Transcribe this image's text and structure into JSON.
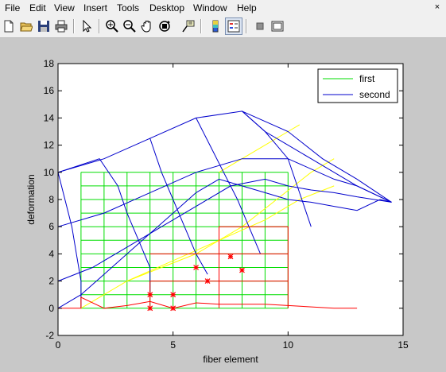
{
  "menu": [
    "File",
    "Edit",
    "View",
    "Insert",
    "Tools",
    "Desktop",
    "Window",
    "Help"
  ],
  "window_close": "×",
  "toolbar": {
    "buttons": [
      {
        "name": "new-figure-icon"
      },
      {
        "name": "open-file-icon"
      },
      {
        "name": "save-icon"
      },
      {
        "name": "print-icon"
      },
      {
        "name": "edit-plot-arrow-icon"
      },
      {
        "name": "zoom-in-icon"
      },
      {
        "name": "zoom-out-icon"
      },
      {
        "name": "pan-hand-icon"
      },
      {
        "name": "rotate-3d-icon"
      },
      {
        "name": "data-cursor-icon"
      },
      {
        "name": "insert-colorbar-icon"
      },
      {
        "name": "insert-legend-icon"
      },
      {
        "name": "hide-plot-tools-icon"
      },
      {
        "name": "show-plot-tools-icon"
      }
    ]
  },
  "chart_data": {
    "type": "line",
    "title": "",
    "xlabel": "fiber element",
    "ylabel": "deformation",
    "xlim": [
      0,
      15
    ],
    "ylim": [
      -2,
      18
    ],
    "xticks": [
      "0",
      "5",
      "10",
      "15"
    ],
    "yticks": [
      "-2",
      "0",
      "2",
      "4",
      "6",
      "8",
      "10",
      "12",
      "14",
      "16",
      "18"
    ],
    "grid": false,
    "legend": {
      "position": "top-right",
      "entries": [
        {
          "label": "first",
          "color": "#00dd00"
        },
        {
          "label": "second",
          "color": "#0000cc"
        }
      ]
    },
    "series": [
      {
        "name": "first",
        "color": "#00dd00",
        "grid_x": [
          1,
          2,
          3,
          4,
          5,
          6,
          7,
          8,
          9,
          10
        ],
        "grid_y": [
          0,
          1,
          2,
          3,
          4,
          5,
          6,
          7,
          8,
          9,
          10
        ]
      },
      {
        "name": "second",
        "color": "#0000cc",
        "i_lines": [
          [
            [
              0,
              0
            ],
            [
              1,
              1
            ],
            [
              2,
              2.5
            ],
            [
              3,
              4
            ],
            [
              4,
              5.5
            ],
            [
              5,
              7
            ],
            [
              6,
              8.5
            ],
            [
              7,
              9.5
            ],
            [
              8,
              9
            ],
            [
              9,
              8.5
            ],
            [
              10,
              8
            ],
            [
              11,
              7.8
            ],
            [
              12,
              7.5
            ],
            [
              13,
              7.2
            ],
            [
              14,
              8
            ],
            [
              14.5,
              7.8
            ]
          ],
          [
            [
              0,
              2
            ],
            [
              1.5,
              3
            ],
            [
              3,
              4.5
            ],
            [
              4.5,
              6
            ],
            [
              6,
              7.5
            ],
            [
              7.5,
              9
            ],
            [
              9,
              9.5
            ],
            [
              10,
              9
            ],
            [
              11,
              8.7
            ],
            [
              12,
              8.5
            ],
            [
              13,
              8.2
            ],
            [
              14.5,
              7.8
            ]
          ],
          [
            [
              0,
              6
            ],
            [
              2,
              7
            ],
            [
              4,
              8.5
            ],
            [
              6,
              10
            ],
            [
              8,
              11
            ],
            [
              10,
              11
            ],
            [
              12,
              9.5
            ],
            [
              13,
              9
            ],
            [
              14.5,
              7.8
            ]
          ],
          [
            [
              0,
              10
            ],
            [
              2,
              11
            ],
            [
              4,
              12.5
            ],
            [
              6,
              14
            ],
            [
              8,
              14.5
            ],
            [
              9,
              13
            ],
            [
              10,
              12
            ],
            [
              11,
              11
            ],
            [
              12,
              10
            ],
            [
              13,
              9
            ],
            [
              14.5,
              7.8
            ]
          ]
        ],
        "j_lines": [
          [
            [
              0,
              10
            ],
            [
              0.3,
              8
            ],
            [
              0.6,
              6
            ],
            [
              0.8,
              4
            ],
            [
              1,
              2
            ],
            [
              1,
              0
            ]
          ],
          [
            [
              0,
              10
            ],
            [
              1.8,
              11
            ],
            [
              2.6,
              9
            ],
            [
              3.0,
              7
            ],
            [
              3.5,
              5
            ],
            [
              4,
              3
            ],
            [
              4,
              1
            ]
          ],
          [
            [
              4,
              12.5
            ],
            [
              4.5,
              10
            ],
            [
              5,
              8
            ],
            [
              5.5,
              6
            ],
            [
              6,
              4
            ],
            [
              6.5,
              2.5
            ]
          ],
          [
            [
              6,
              14
            ],
            [
              6.6,
              12
            ],
            [
              7.2,
              10
            ],
            [
              7.8,
              8
            ],
            [
              8.3,
              6
            ],
            [
              8.8,
              4
            ]
          ],
          [
            [
              8,
              14.5
            ],
            [
              9,
              13
            ],
            [
              9.5,
              12
            ],
            [
              10,
              11
            ],
            [
              10.3,
              9.5
            ],
            [
              10.6,
              8
            ],
            [
              11,
              6
            ]
          ],
          [
            [
              8,
              14.5
            ],
            [
              10,
              13
            ],
            [
              11.5,
              11
            ],
            [
              13,
              9.5
            ],
            [
              14.5,
              7.8
            ]
          ]
        ]
      },
      {
        "name": "",
        "color": "#ff0000",
        "points": [
          [
            7,
            0
          ],
          [
            7,
            6
          ],
          [
            10,
            6
          ],
          [
            10,
            0
          ],
          [
            4,
            0
          ],
          [
            4,
            2
          ],
          [
            10,
            2
          ],
          [
            10,
            4
          ],
          [
            7,
            4
          ]
        ],
        "segments": [
          [
            [
              0,
              0
            ],
            [
              1,
              0
            ],
            [
              1,
              0.8
            ],
            [
              2,
              0
            ],
            [
              3,
              0.2
            ],
            [
              4,
              0.5
            ],
            [
              5,
              0
            ],
            [
              6,
              0.4
            ],
            [
              7,
              0.3
            ],
            [
              8,
              0.3
            ],
            [
              9,
              0.3
            ],
            [
              10,
              0.2
            ],
            [
              12,
              0
            ],
            [
              13,
              0
            ]
          ],
          [
            [
              4,
              0
            ],
            [
              4,
              2
            ],
            [
              10,
              2
            ]
          ],
          [
            [
              7,
              0
            ],
            [
              7,
              6
            ],
            [
              10,
              6
            ],
            [
              10,
              0
            ]
          ],
          [
            [
              4,
              4
            ],
            [
              10,
              4
            ]
          ]
        ],
        "markers": [
          [
            4,
            1
          ],
          [
            4,
            0
          ],
          [
            5,
            1
          ],
          [
            5,
            0
          ],
          [
            6,
            3
          ],
          [
            6.5,
            2
          ],
          [
            7.5,
            3.8
          ],
          [
            8,
            2.8
          ]
        ]
      },
      {
        "name": "",
        "color": "#ffff00",
        "segments": [
          [
            [
              1,
              0
            ],
            [
              3,
              2
            ],
            [
              5,
              3.5
            ],
            [
              7,
              5
            ],
            [
              9,
              6.5
            ],
            [
              10.5,
              8
            ],
            [
              12,
              9
            ]
          ],
          [
            [
              3,
              2
            ],
            [
              6,
              4
            ],
            [
              8,
              6
            ],
            [
              9.5,
              8
            ],
            [
              11,
              10
            ],
            [
              12,
              11
            ]
          ],
          [
            [
              7,
              10
            ],
            [
              9,
              12
            ],
            [
              10,
              13
            ],
            [
              10.5,
              13.5
            ]
          ]
        ]
      }
    ]
  }
}
